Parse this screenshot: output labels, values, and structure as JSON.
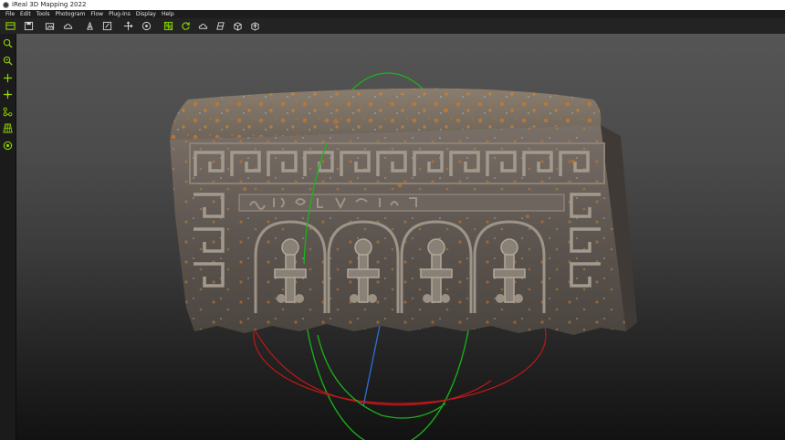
{
  "window": {
    "title": "iReal 3D Mapping 2022"
  },
  "menu": [
    "File",
    "Edit",
    "Tools",
    "Photogram",
    "Flow",
    "Plug-Ins",
    "Display",
    "Help"
  ],
  "toolbar_icons": [
    "layout-icon",
    "save-icon",
    "import-image-icon",
    "cloud-icon",
    "run-icon",
    "edit-icon",
    "move-icon",
    "target-icon",
    "mesh-icon",
    "refresh-icon",
    "cloud-icon",
    "texture-icon",
    "model-icon",
    "export-icon"
  ],
  "sidebar_icons": [
    "zoom-fit-icon",
    "zoom-region-icon",
    "pan-icon",
    "axis-icon",
    "points-icon",
    "grid-icon",
    "orbit-target-icon"
  ],
  "colors": {
    "accent": "#8fd400",
    "gizmo_x": "#c01818",
    "gizmo_y": "#19b419",
    "gizmo_z": "#2f6ed8"
  }
}
